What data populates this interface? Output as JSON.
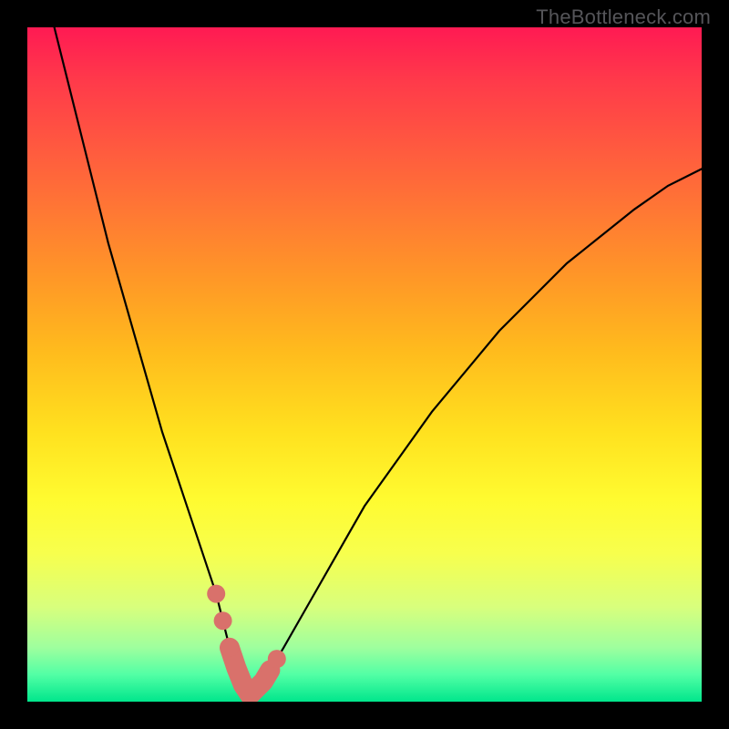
{
  "watermark": "TheBottleneck.com",
  "colors": {
    "pink_highlight": "#d9716b",
    "curve": "#000000",
    "frame": "#000000"
  },
  "chart_data": {
    "type": "line",
    "title": "",
    "xlabel": "",
    "ylabel": "",
    "xlim": [
      0,
      100
    ],
    "ylim": [
      0,
      100
    ],
    "description": "Bottleneck-style V curve over a red-to-green vertical heat gradient. Y is bottleneck percentage (low = green/good). Minimum (optimal point) sits around x≈33 of the horizontal axis.",
    "series": [
      {
        "name": "left-branch",
        "x": [
          4,
          6,
          8,
          10,
          12,
          14,
          16,
          18,
          20,
          22,
          24,
          26,
          28,
          29,
          30,
          31,
          32,
          33
        ],
        "y": [
          100,
          92,
          84,
          76,
          68,
          61,
          54,
          47,
          40,
          34,
          28,
          22,
          16,
          12,
          8,
          5,
          2.5,
          1
        ]
      },
      {
        "name": "right-branch",
        "x": [
          33,
          35,
          38,
          42,
          46,
          50,
          55,
          60,
          65,
          70,
          75,
          80,
          85,
          90,
          95,
          100
        ],
        "y": [
          1,
          3,
          8,
          15,
          22,
          29,
          36,
          43,
          49,
          55,
          60,
          65,
          69,
          73,
          76.5,
          79
        ]
      }
    ],
    "highlight": {
      "name": "near-optimal-range",
      "left_dots_x": [
        28,
        29,
        30
      ],
      "right_dots_x": [
        36,
        37
      ],
      "segment_x": [
        30,
        31,
        32,
        33,
        34,
        35,
        36
      ]
    }
  }
}
